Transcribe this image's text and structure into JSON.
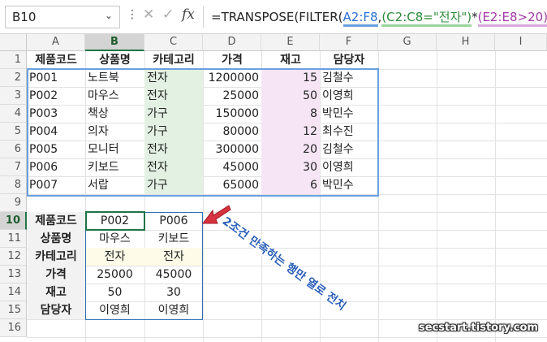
{
  "name_box": "B10",
  "formula_parts": {
    "p0": "=TRANSPOSE(FILTER(",
    "p1": "A2:F8",
    "p2": ",",
    "p3": "(C2:C8=\"전자\")",
    "p4": "*",
    "p5": "(E2:E8>20)",
    "p6": "))"
  },
  "columns": [
    "A",
    "B",
    "C",
    "D",
    "E",
    "F",
    "G",
    "H",
    "I"
  ],
  "rows": [
    "1",
    "2",
    "3",
    "4",
    "5",
    "6",
    "7",
    "8",
    "9",
    "10",
    "11",
    "12",
    "13",
    "14",
    "15",
    "16"
  ],
  "headers": [
    "제품코드",
    "상품명",
    "카테고리",
    "가격",
    "재고",
    "담당자"
  ],
  "records": [
    [
      "P001",
      "노트북",
      "전자",
      "1200000",
      "15",
      "김철수"
    ],
    [
      "P002",
      "마우스",
      "전자",
      "25000",
      "50",
      "이영희"
    ],
    [
      "P003",
      "책상",
      "가구",
      "150000",
      "8",
      "박민수"
    ],
    [
      "P004",
      "의자",
      "가구",
      "80000",
      "12",
      "최수진"
    ],
    [
      "P005",
      "모니터",
      "전자",
      "300000",
      "20",
      "김철수"
    ],
    [
      "P006",
      "키보드",
      "전자",
      "45000",
      "30",
      "이영희"
    ],
    [
      "P007",
      "서랍",
      "가구",
      "65000",
      "6",
      "박민수"
    ]
  ],
  "result": [
    [
      "제품코드",
      "P002",
      "P006"
    ],
    [
      "상품명",
      "마우스",
      "키보드"
    ],
    [
      "카테고리",
      "전자",
      "전자"
    ],
    [
      "가격",
      "25000",
      "45000"
    ],
    [
      "재고",
      "50",
      "30"
    ],
    [
      "담당자",
      "이영희",
      "이영희"
    ]
  ],
  "annotation": "2조건 만족하는 행만 열로 전치",
  "watermark": "secstart.tistory.com",
  "icons": {
    "cancel": "close-icon",
    "enter": "check-icon",
    "function": "fx-icon"
  },
  "colors": {
    "accent": "#217346",
    "source_border": "#6aa0e0",
    "output_border": "#2f6fb5",
    "annotation": "#2b5fb8"
  }
}
